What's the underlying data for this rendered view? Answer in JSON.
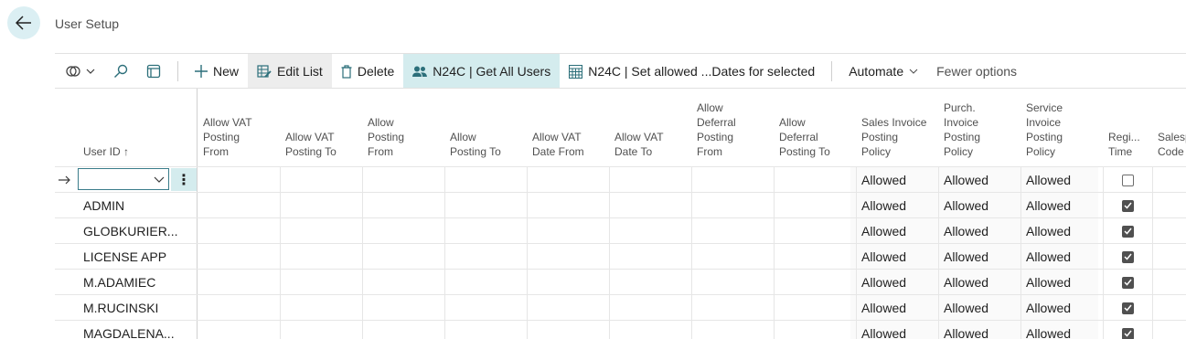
{
  "page": {
    "title": "User Setup"
  },
  "actionbar": {
    "new_label": "New",
    "edit_list_label": "Edit List",
    "delete_label": "Delete",
    "get_all_users_label": "N24C | Get All Users",
    "set_allowed_label": "N24C | Set allowed ...Dates for selected",
    "automate_label": "Automate",
    "fewer_options_label": "Fewer options"
  },
  "columns": {
    "user_id": "User ID ↑",
    "allow_vat_posting_from": [
      "Allow VAT",
      "Posting",
      "From"
    ],
    "allow_vat_posting_to": [
      "Allow VAT",
      "Posting To"
    ],
    "allow_posting_from": [
      "Allow",
      "Posting",
      "From"
    ],
    "allow_posting_to": [
      "Allow",
      "Posting To"
    ],
    "allow_vat_date_from": [
      "Allow VAT",
      "Date From"
    ],
    "allow_vat_date_to": [
      "Allow VAT",
      "Date To"
    ],
    "allow_deferral_posting_from": [
      "Allow",
      "Deferral",
      "Posting",
      "From"
    ],
    "allow_deferral_posting_to": [
      "Allow",
      "Deferral",
      "Posting To"
    ],
    "sales_invoice_posting_policy": [
      "Sales Invoice",
      "Posting",
      "Policy"
    ],
    "purch_invoice_posting_policy": [
      "Purch.",
      "Invoice",
      "Posting",
      "Policy"
    ],
    "service_invoice_posting_policy": [
      "Service",
      "Invoice",
      "Posting",
      "Policy"
    ],
    "register_time": [
      "Regi...",
      "Time"
    ],
    "salesperson_code": [
      "Salesp",
      "Code"
    ]
  },
  "rows": [
    {
      "user_id": "",
      "sales_policy": "Allowed",
      "purch_policy": "Allowed",
      "service_policy": "Allowed",
      "register_time": false,
      "current": true
    },
    {
      "user_id": "ADMIN",
      "sales_policy": "Allowed",
      "purch_policy": "Allowed",
      "service_policy": "Allowed",
      "register_time": true
    },
    {
      "user_id": "GLOBKURIER...",
      "sales_policy": "Allowed",
      "purch_policy": "Allowed",
      "service_policy": "Allowed",
      "register_time": true
    },
    {
      "user_id": "LICENSE APP",
      "sales_policy": "Allowed",
      "purch_policy": "Allowed",
      "service_policy": "Allowed",
      "register_time": true
    },
    {
      "user_id": "M.ADAMIEC",
      "sales_policy": "Allowed",
      "purch_policy": "Allowed",
      "service_policy": "Allowed",
      "register_time": true
    },
    {
      "user_id": "M.RUCINSKI",
      "sales_policy": "Allowed",
      "purch_policy": "Allowed",
      "service_policy": "Allowed",
      "register_time": true
    },
    {
      "user_id": "MAGDALENA...",
      "sales_policy": "Allowed",
      "purch_policy": "Allowed",
      "service_policy": "Allowed",
      "register_time": true
    }
  ],
  "colors": {
    "accent": "#008489",
    "teal_bg": "#d4ecee",
    "back_bg": "#dbeff3"
  }
}
